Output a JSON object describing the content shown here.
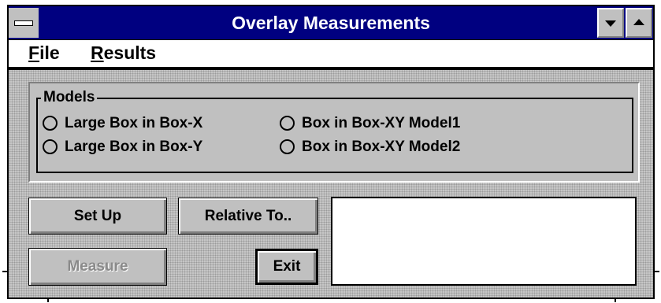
{
  "window": {
    "title": "Overlay Measurements"
  },
  "menu": {
    "file_first": "F",
    "file_rest": "ile",
    "results_first": "R",
    "results_rest": "esults"
  },
  "models": {
    "group_label": "Models",
    "options": [
      {
        "label": "Large Box in Box-X",
        "selected": false
      },
      {
        "label": "Large Box in Box-Y",
        "selected": false
      },
      {
        "label": "Box in Box-XY Model1",
        "selected": false
      },
      {
        "label": "Box in Box-XY Model2",
        "selected": false
      }
    ]
  },
  "buttons": {
    "setup": "Set Up",
    "relative_to": "Relative To..",
    "measure": "Measure",
    "exit": "Exit"
  },
  "icons": {
    "system_menu": "system-menu-icon",
    "minimize": "minimize-triangle-icon",
    "maximize": "maximize-triangle-icon"
  },
  "colors": {
    "title_bar": "#000080",
    "face": "#c0c0c0"
  }
}
